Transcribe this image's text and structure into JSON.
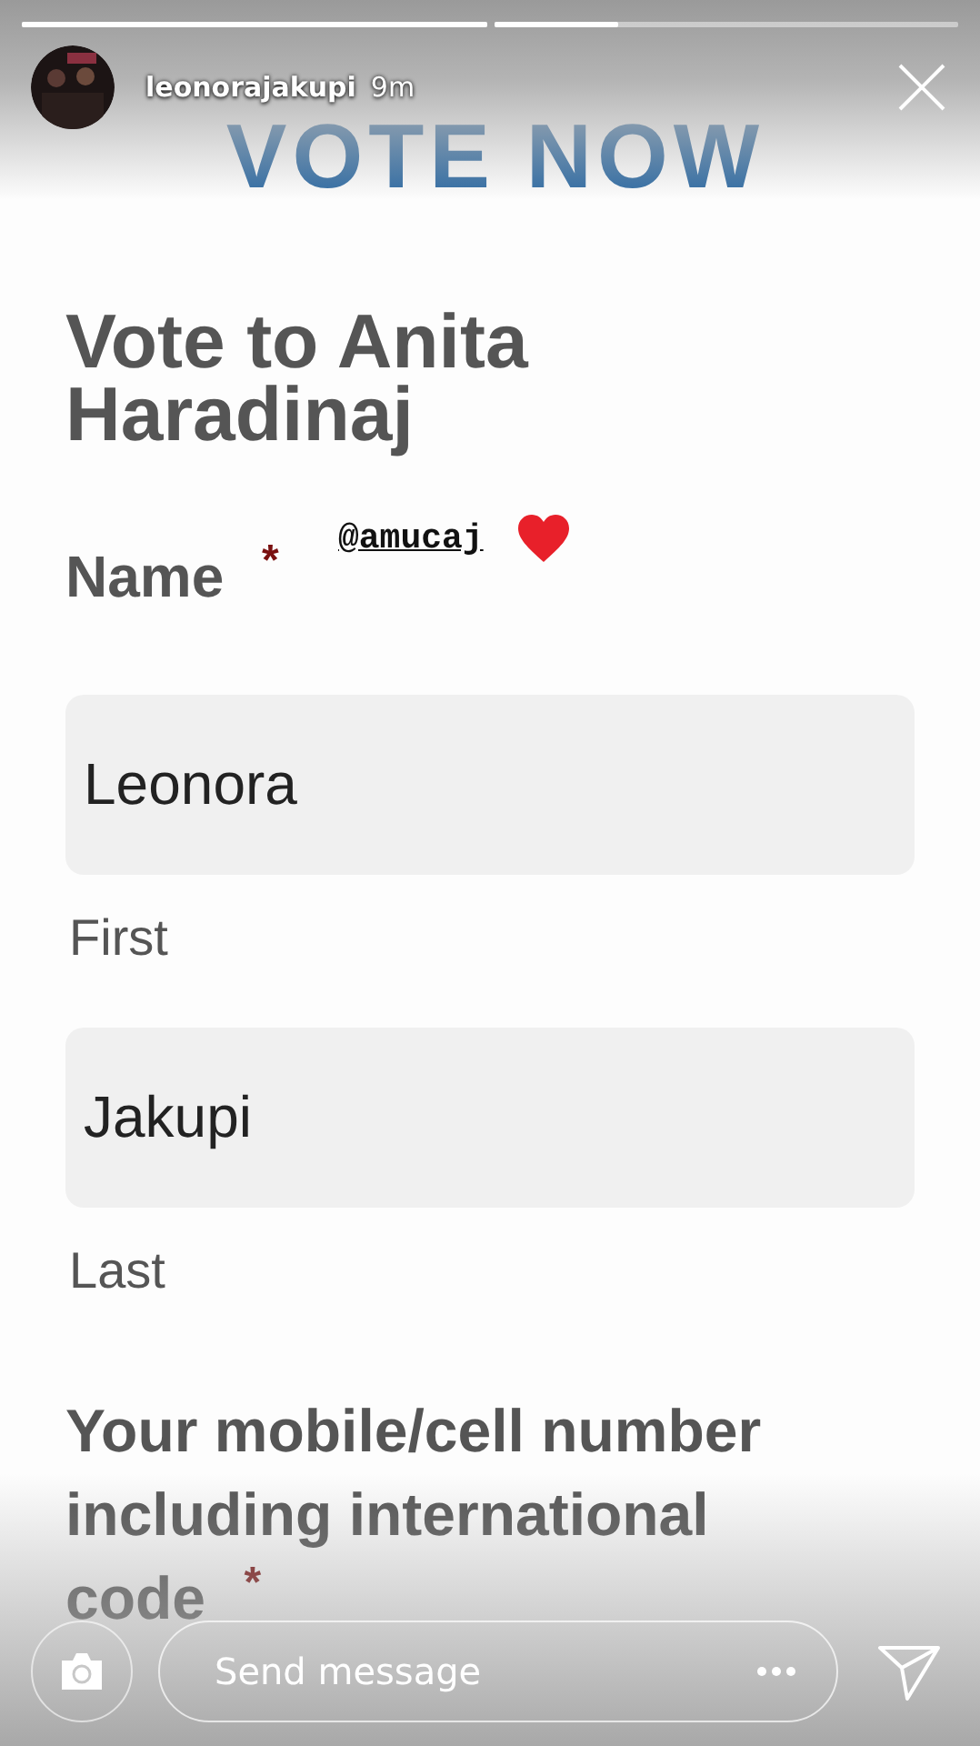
{
  "story": {
    "progress": [
      {
        "level": 1
      },
      {
        "level": 0.27
      }
    ],
    "username": "leonorajakupi",
    "time": "9m",
    "mention": "@amucaj"
  },
  "form": {
    "banner": "VOTE NOW",
    "title": "Vote to Anita Haradinaj",
    "fields": [
      {
        "label": "Name",
        "required_mark": "*",
        "inputs": [
          {
            "kind": "text",
            "value": "Leonora",
            "sublabel": "First"
          },
          {
            "kind": "text",
            "value": "Jakupi",
            "sublabel": "Last"
          }
        ]
      },
      {
        "label": "Your mobile/cell number including international code",
        "required_mark": "*"
      }
    ]
  },
  "reply_bar": {
    "placeholder": "Send message"
  }
}
